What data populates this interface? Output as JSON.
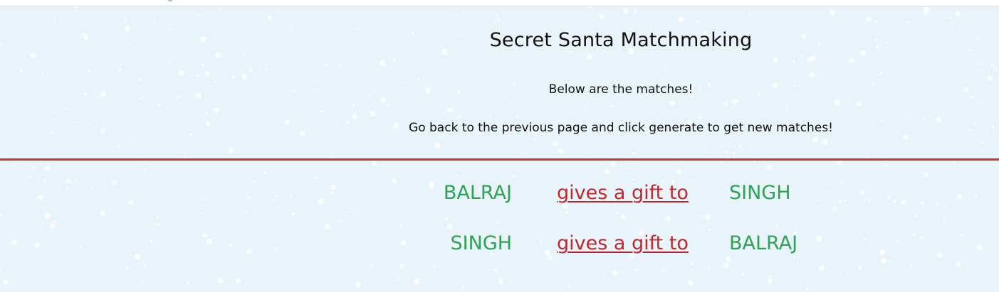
{
  "page": {
    "title": "Secret Santa Matchmaking",
    "subtitle_1": "Below are the matches!",
    "subtitle_2": "Go back to the previous page and click generate to get new matches!"
  },
  "matches": [
    {
      "giver": "BALRAJ",
      "link_text": "gives a gift to",
      "receiver": "SINGH"
    },
    {
      "giver": "SINGH",
      "link_text": "gives a gift to",
      "receiver": "BALRAJ"
    }
  ],
  "colors": {
    "background": "#e8f3fa",
    "divider": "#c0392b",
    "name": "#2ea356",
    "link": "#c0282d",
    "snow": "#ffffff"
  }
}
